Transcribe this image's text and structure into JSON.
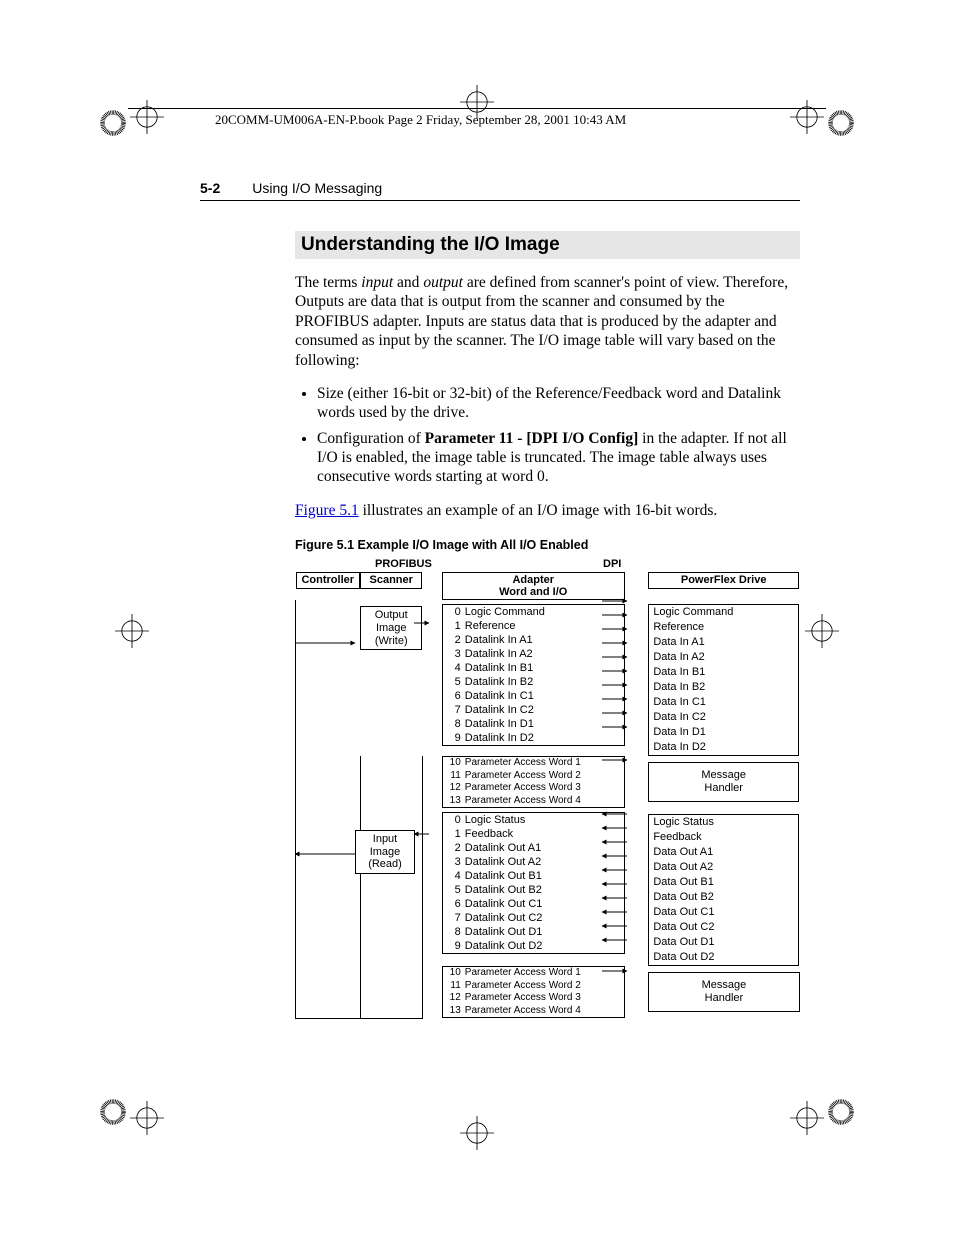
{
  "bookline": "20COMM-UM006A-EN-P.book  Page 2  Friday, September 28, 2001  10:43 AM",
  "runhead": {
    "page": "5-2",
    "title": "Using I/O Messaging"
  },
  "h2": "Understanding the I/O Image",
  "intro_html": "The terms <em>input</em> and <em>output</em> are defined from scanner's point of view. Therefore, Outputs are data that is output from the scanner and consumed by the PROFIBUS adapter. Inputs are status data that is produced by the adapter and consumed as input by the scanner. The I/O image table will vary based on the following:",
  "bullets": [
    "Size (either 16-bit or 32-bit) of the Reference/Feedback word and Datalink words used by the drive.",
    "Configuration of <b>Parameter 11 - [DPI I/O Config]</b> in the adapter. If not all I/O is enabled, the image table is truncated. The image table always uses consecutive words starting at word 0."
  ],
  "leadin_pre": "",
  "figref": "Figure 5.1",
  "leadin_post": " illustrates an example of an I/O image with 16-bit words.",
  "figcap": "Figure 5.1   Example I/O Image with All I/O Enabled",
  "labels": {
    "profibus": "PROFIBUS",
    "dpi": "DPI",
    "controller": "Controller",
    "scanner": "Scanner",
    "adapter1": "Adapter",
    "adapter2": "Word and I/O",
    "drive": "PowerFlex Drive",
    "out1": "Output",
    "out2": "Image",
    "out3": "(Write)",
    "in1": "Input",
    "in2": "Image",
    "in3": "(Read)",
    "msg1": "Message",
    "msg2": "Handler"
  },
  "adapter_out": [
    {
      "n": "0",
      "t": "Logic Command"
    },
    {
      "n": "1",
      "t": "Reference"
    },
    {
      "n": "2",
      "t": "Datalink In A1"
    },
    {
      "n": "3",
      "t": "Datalink In A2"
    },
    {
      "n": "4",
      "t": "Datalink In B1"
    },
    {
      "n": "5",
      "t": "Datalink In B2"
    },
    {
      "n": "6",
      "t": "Datalink In C1"
    },
    {
      "n": "7",
      "t": "Datalink In C2"
    },
    {
      "n": "8",
      "t": "Datalink In D1"
    },
    {
      "n": "9",
      "t": "Datalink In D2"
    }
  ],
  "adapter_out_pw": [
    {
      "n": "10",
      "t": "Parameter Access Word 1"
    },
    {
      "n": "11",
      "t": "Parameter Access Word 2"
    },
    {
      "n": "12",
      "t": "Parameter Access Word 3"
    },
    {
      "n": "13",
      "t": "Parameter Access Word 4"
    }
  ],
  "adapter_in": [
    {
      "n": "0",
      "t": "Logic Status"
    },
    {
      "n": "1",
      "t": "Feedback"
    },
    {
      "n": "2",
      "t": "Datalink Out A1"
    },
    {
      "n": "3",
      "t": "Datalink Out A2"
    },
    {
      "n": "4",
      "t": "Datalink Out B1"
    },
    {
      "n": "5",
      "t": "Datalink Out B2"
    },
    {
      "n": "6",
      "t": "Datalink Out C1"
    },
    {
      "n": "7",
      "t": "Datalink Out C2"
    },
    {
      "n": "8",
      "t": "Datalink Out D1"
    },
    {
      "n": "9",
      "t": "Datalink Out D2"
    }
  ],
  "adapter_in_pw": [
    {
      "n": "10",
      "t": "Parameter Access Word 1"
    },
    {
      "n": "11",
      "t": "Parameter Access Word 2"
    },
    {
      "n": "12",
      "t": "Parameter Access Word 3"
    },
    {
      "n": "13",
      "t": "Parameter Access Word 4"
    }
  ],
  "drive_out": [
    "Logic Command",
    "Reference",
    "Data In A1",
    "Data In A2",
    "Data In B1",
    "Data In B2",
    "Data In C1",
    "Data In C2",
    "Data In D1",
    "Data In D2"
  ],
  "drive_in": [
    "Logic Status",
    "Feedback",
    "Data Out A1",
    "Data Out A2",
    "Data Out B1",
    "Data Out B2",
    "Data Out C1",
    "Data Out C2",
    "Data Out D1",
    "Data Out D2"
  ]
}
